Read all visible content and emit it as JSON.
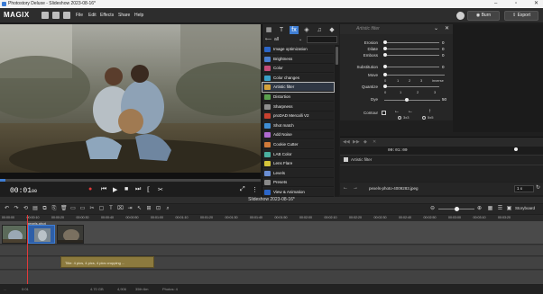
{
  "window": {
    "title": "Photostory Deluxe - Slideshow 2023-08-16*"
  },
  "menubar": {
    "logo": "MAGIX",
    "items": [
      "File",
      "Edit",
      "Effects",
      "Share",
      "Help"
    ],
    "burn_label": "Burn",
    "export_label": "Export"
  },
  "preview": {
    "timecode": "00:01",
    "timecode_frames": "00"
  },
  "effects": {
    "filter_value": "all",
    "items": [
      {
        "label": "Image optimization",
        "color": "#2c66c8"
      },
      {
        "label": "Brightness",
        "color": "#4a7fd0"
      },
      {
        "label": "Color",
        "color": "#c44d7a"
      },
      {
        "label": "Color changes",
        "color": "#3aa0c8"
      },
      {
        "label": "Artistic filter",
        "color": "#d4a23b"
      },
      {
        "label": "Distortion",
        "color": "#5aa04e"
      },
      {
        "label": "Sharpness",
        "color": "#8e8e8e"
      },
      {
        "label": "proDAD Mercalli V2",
        "color": "#c8412f"
      },
      {
        "label": "Shot match",
        "color": "#3f8ed4"
      },
      {
        "label": "Add Noise",
        "color": "#b06ad0"
      },
      {
        "label": "Cookie Cutter",
        "color": "#d07a3a"
      },
      {
        "label": "LAB Color",
        "color": "#4ab0a0"
      },
      {
        "label": "Lens Flare",
        "color": "#d4c43a"
      },
      {
        "label": "Levels",
        "color": "#6a8ed4"
      },
      {
        "label": "Presets",
        "color": "#8a8a8a"
      },
      {
        "label": "View & Animation",
        "color": "#2c66c8"
      }
    ]
  },
  "properties": {
    "title": "Artistic filter",
    "rows": [
      {
        "label": "Erosion",
        "value": "0"
      },
      {
        "label": "Dilate",
        "value": "0"
      },
      {
        "label": "Emboss",
        "value": "0"
      },
      {
        "label": "Substitution",
        "value": "0"
      }
    ],
    "move_label": "Move",
    "move_ticks": [
      "0",
      "1",
      "2",
      "3",
      "inverse"
    ],
    "quantize_label": "Quantize",
    "quantize_ticks": [
      "0",
      "1",
      "2",
      "3"
    ],
    "dye_label": "Dye",
    "dye_value": "50",
    "contour_label": "Contour",
    "contour_opts": [
      "3x3",
      "5x5"
    ]
  },
  "keyframe": {
    "timecode": "00:01:00",
    "track_label": "Artistic filter",
    "file": "pexels-photo-4009283.jpeg",
    "zoom": "1 x"
  },
  "timeline": {
    "title": "Slideshow 2023-08-16*",
    "storyboard_label": "Storyboard",
    "ruler": [
      "00:00:00",
      "00:00:10",
      "00:00:20",
      "00:00:30",
      "00:00:40",
      "00:00:50",
      "00:01:00",
      "00:01:10",
      "00:01:20",
      "00:01:30",
      "00:01:40",
      "00:01:50",
      "00:02:00",
      "00:02:10",
      "00:02:20",
      "00:02:30",
      "00:02:40",
      "00:02:50",
      "00:03:00",
      "00:03:10",
      "00:03:20"
    ],
    "clip1_label": "pexels-phot",
    "text_clip": "Title: 4 pics, 4 pics, 4 pics cropping ..."
  },
  "statusbar": {
    "items": [
      "...",
      "0:01",
      "4.70 GB",
      "4,906",
      "35th 6m",
      "Photos: 4"
    ]
  }
}
